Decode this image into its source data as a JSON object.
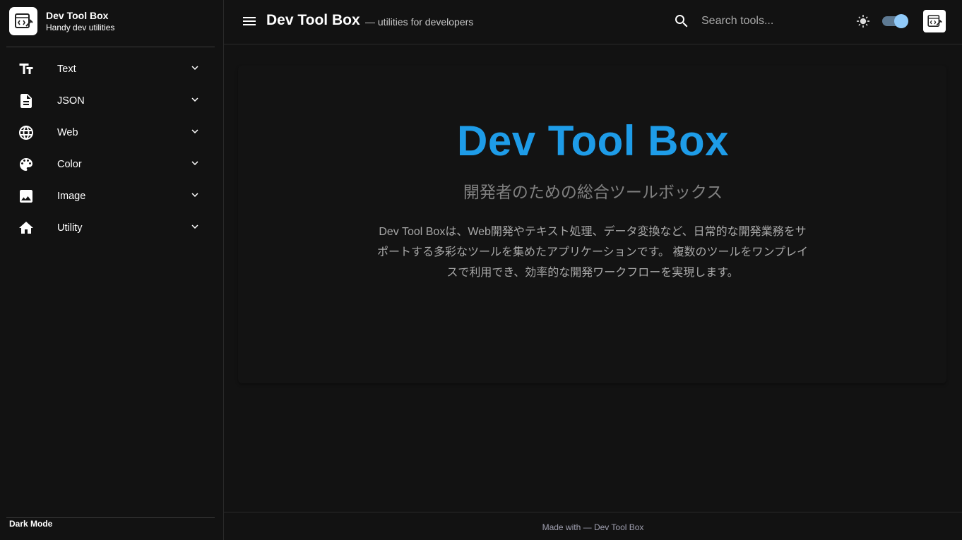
{
  "sidebar": {
    "brand": {
      "title": "Dev Tool Box",
      "subtitle": "Handy dev utilities",
      "logo_icon": "toolbox-code-icon"
    },
    "items": [
      {
        "label": "Text",
        "icon": "text-fields-icon"
      },
      {
        "label": "JSON",
        "icon": "document-icon"
      },
      {
        "label": "Web",
        "icon": "globe-icon"
      },
      {
        "label": "Color",
        "icon": "palette-icon"
      },
      {
        "label": "Image",
        "icon": "image-icon"
      },
      {
        "label": "Utility",
        "icon": "home-icon"
      }
    ],
    "footer_label": "Dark Mode"
  },
  "header": {
    "title": "Dev Tool Box",
    "subtitle": "— utilities for developers",
    "search_placeholder": "Search tools...",
    "search_value": "",
    "theme_toggle_on": true
  },
  "hero": {
    "title": "Dev Tool Box",
    "subtitle": "開発者のための総合ツールボックス",
    "description": "Dev Tool Boxは、Web開発やテキスト処理、データ変換など、日常的な開発業務をサポートする多彩なツールを集めたアプリケーションです。 複数のツールをワンプレイスで利用でき、効率的な開発ワークフローを実現します。"
  },
  "footer": {
    "text": "Made with — Dev Tool Box"
  },
  "colors": {
    "background": "#121212",
    "accent": "#1e9ce8",
    "toggle_thumb": "#90caf9",
    "toggle_track": "#5e7a93"
  }
}
